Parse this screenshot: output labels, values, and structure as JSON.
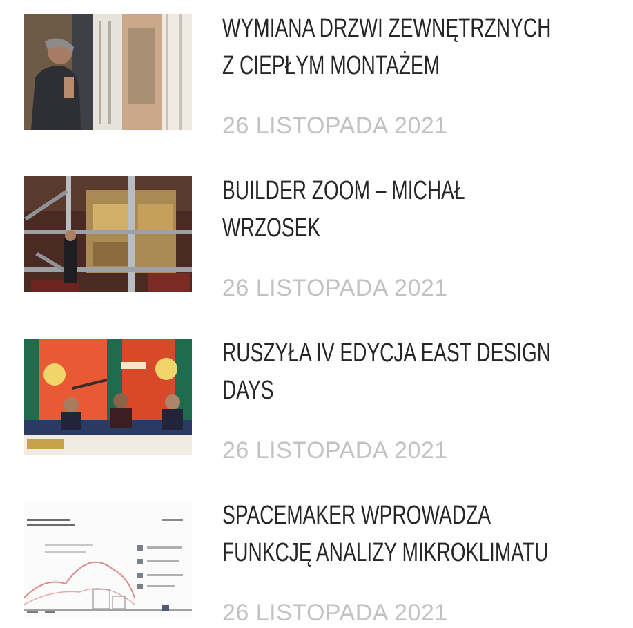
{
  "posts": [
    {
      "title_lines": [
        "WYMIANA DRZWI ZEWNĘTRZNYCH",
        "Z CIEPŁYM MONTAŻEM"
      ],
      "date": "26 LISTOPADA 2021",
      "image": "man-at-door-photo"
    },
    {
      "title_lines": [
        "BUILDER ZOOM – MICHAŁ",
        "WRZOSEK"
      ],
      "date": "26 LISTOPADA 2021",
      "image": "building-interior-photo"
    },
    {
      "title_lines": [
        "RUSZYŁA IV EDYCJA EAST DESIGN",
        "DAYS"
      ],
      "date": "26 LISTOPADA 2021",
      "image": "press-conference-photo"
    },
    {
      "title_lines": [
        "SPACEMAKER WPROWADZA",
        "FUNKCJĘ ANALIZY MIKROKLIMATU"
      ],
      "date": "26 LISTOPADA 2021",
      "image": "microclimate-diagram-image"
    }
  ],
  "colors": {
    "title": "#262626",
    "date": "#c2c2c2",
    "background": "#ffffff"
  }
}
